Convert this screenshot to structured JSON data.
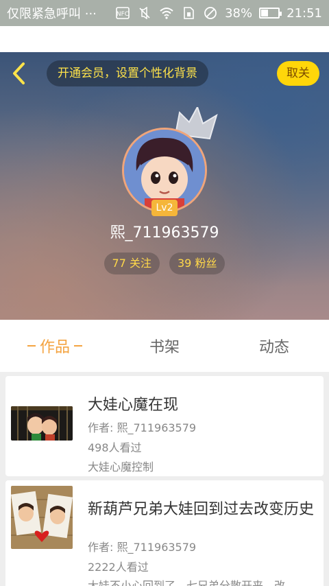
{
  "status_bar": {
    "carrier_text": "仅限紧急呼叫 ···",
    "battery_percent": "38%",
    "battery_level": 0.38,
    "time": "21:51",
    "icons": [
      "nfc-icon",
      "mute-icon",
      "wifi-icon",
      "sim-icon",
      "dnd-icon",
      "battery-icon"
    ]
  },
  "header": {
    "back_icon": "chevron-left-icon",
    "vip_prompt": "开通会员，设置个性化背景",
    "cancel_label": "取关"
  },
  "profile": {
    "username": "熙_711963579",
    "level": "Lv2",
    "following": "77 关注",
    "fans": "39 粉丝"
  },
  "tabs": [
    {
      "label": "作品",
      "active": true
    },
    {
      "label": "书架",
      "active": false
    },
    {
      "label": "动态",
      "active": false
    }
  ],
  "works": [
    {
      "title": "大娃心魔在现",
      "author": "作者: 熙_711963579",
      "views": "498人看过",
      "summary": "大娃心魔控制"
    },
    {
      "title": "新葫芦兄弟大娃回到过去改变历史",
      "author": "作者: 熙_711963579",
      "views": "2222人看过",
      "summary": "大娃不小心回到了，七兄弟分散开来，改"
    }
  ],
  "colors": {
    "accent": "#f4a340",
    "badge_yellow": "#ffd60a",
    "stat_text": "#ffd84a"
  }
}
